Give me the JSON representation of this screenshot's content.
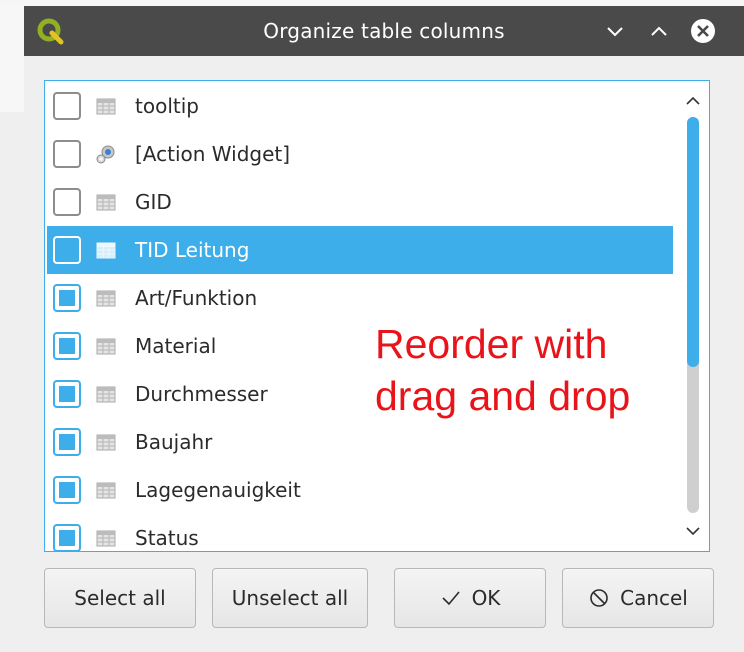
{
  "dialog": {
    "title": "Organize table columns",
    "app_icon": "qgis-logo-icon",
    "window_buttons": [
      "minimize-icon",
      "maximize-icon",
      "close-icon"
    ]
  },
  "columns": [
    {
      "label": "tooltip",
      "checked": false,
      "icon": "table-column-icon"
    },
    {
      "label": "[Action Widget]",
      "checked": false,
      "icon": "action-gear-icon"
    },
    {
      "label": "GID",
      "checked": false,
      "icon": "table-column-icon"
    },
    {
      "label": "TID Leitung",
      "checked": false,
      "icon": "table-column-icon",
      "selected": true
    },
    {
      "label": "Art/Funktion",
      "checked": true,
      "icon": "table-column-icon"
    },
    {
      "label": "Material",
      "checked": true,
      "icon": "table-column-icon"
    },
    {
      "label": "Durchmesser",
      "checked": true,
      "icon": "table-column-icon"
    },
    {
      "label": "Baujahr",
      "checked": true,
      "icon": "table-column-icon"
    },
    {
      "label": "Lagegenauigkeit",
      "checked": true,
      "icon": "table-column-icon"
    },
    {
      "label": "Status",
      "checked": true,
      "icon": "table-column-icon"
    }
  ],
  "annotation": {
    "text": "Reorder with\ndrag and drop",
    "color": "#e8141a"
  },
  "buttons": {
    "select_all": "Select all",
    "unselect_all": "Unselect all",
    "ok": "OK",
    "cancel": "Cancel"
  },
  "colors": {
    "accent": "#3daee9",
    "titlebar": "#4a4a4a"
  }
}
